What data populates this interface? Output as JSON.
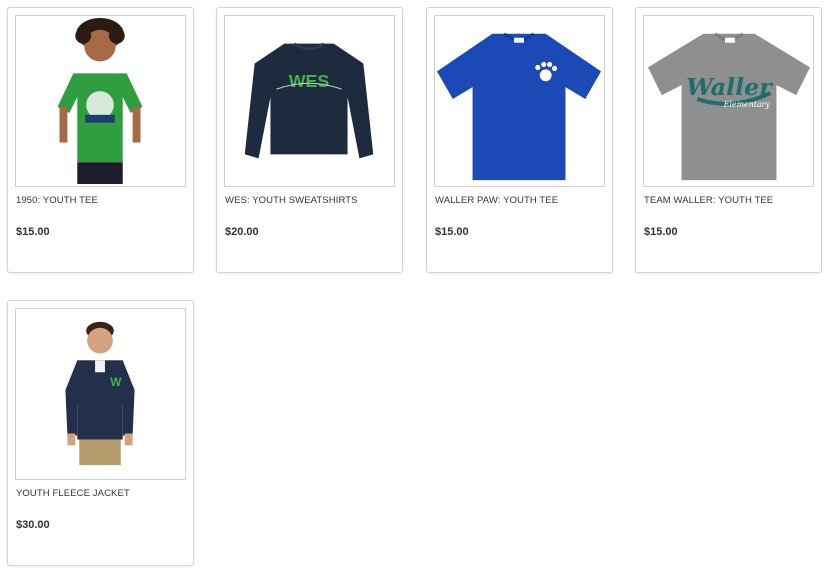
{
  "products": [
    {
      "name": "1950: YOUTH TEE",
      "price": "$15.00",
      "image_icon": "kid-green-tee-image"
    },
    {
      "name": "WES: YOUTH SWEATSHIRTS",
      "price": "$20.00",
      "image_icon": "navy-sweatshirt-image"
    },
    {
      "name": "WALLER PAW: YOUTH TEE",
      "price": "$15.00",
      "image_icon": "blue-paw-tee-image"
    },
    {
      "name": "TEAM WALLER: YOUTH TEE",
      "price": "$15.00",
      "image_icon": "gray-waller-tee-image"
    },
    {
      "name": "YOUTH FLEECE JACKET",
      "price": "$30.00",
      "image_icon": "boy-fleece-jacket-image"
    }
  ],
  "graphics": {
    "sweatshirt_text": "WES",
    "tee_text": "Waller",
    "tee_subtext": "Elementary"
  },
  "colors": {
    "green_tee": "#2f9e3f",
    "navy": "#1e2a3e",
    "royal_blue": "#1b49b6",
    "heather_gray": "#8f8f8f",
    "logo_green": "#3cb54a",
    "logo_teal": "#1d6e6e"
  }
}
